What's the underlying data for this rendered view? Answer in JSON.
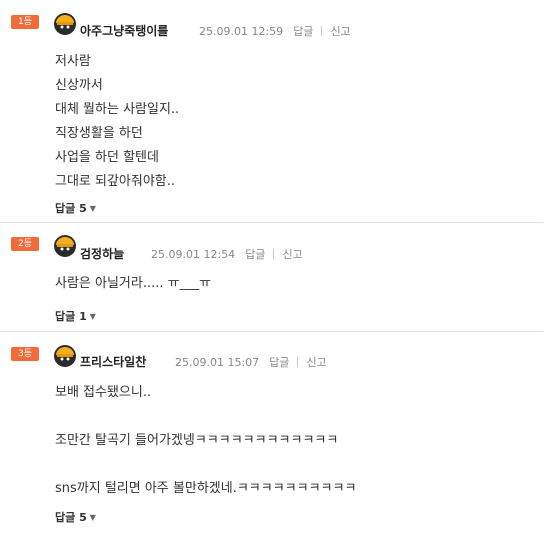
{
  "comments": [
    {
      "rank": "1등",
      "nickname": "아주그냥죽탱이를",
      "date": "25.09.01 12:59",
      "reply_label": "답글",
      "report_label": "신고",
      "lines": [
        "저사람",
        "신상까서",
        "대체 뭘하는 사람일지..",
        "직장생활을 하던",
        "사업을 하던 할텐데",
        "그대로 되갚아줘야함.."
      ],
      "replies_label": "답글 5"
    },
    {
      "rank": "2등",
      "nickname": "검정하늘",
      "date": "25.09.01 12:54",
      "reply_label": "답글",
      "report_label": "신고",
      "lines": [
        "사람은 아닐거라..... ㅠ___ㅠ"
      ],
      "replies_label": "답글 1"
    },
    {
      "rank": "3등",
      "nickname": "프리스타일찬",
      "date": "25.09.01 15:07",
      "reply_label": "답글",
      "report_label": "신고",
      "lines": [
        "보배 접수됐으니..",
        "",
        "조만간 탈곡기 들어가겠넹ㅋㅋㅋㅋㅋㅋㅋㅋㅋㅋㅋㅋ",
        "",
        "sns까지 털리면 아주 볼만하겠네.ㅋㅋㅋㅋㅋㅋㅋㅋㅋㅋ"
      ],
      "replies_label": "답글 5"
    }
  ],
  "colors": {
    "rank_badge": "#f26b3b",
    "separator": "#e3e3e3",
    "avatar_helmet": "#f2b01e"
  },
  "icons": {
    "avatar": "helmet-face-avatar-icon",
    "caret": "caret-down-icon"
  }
}
